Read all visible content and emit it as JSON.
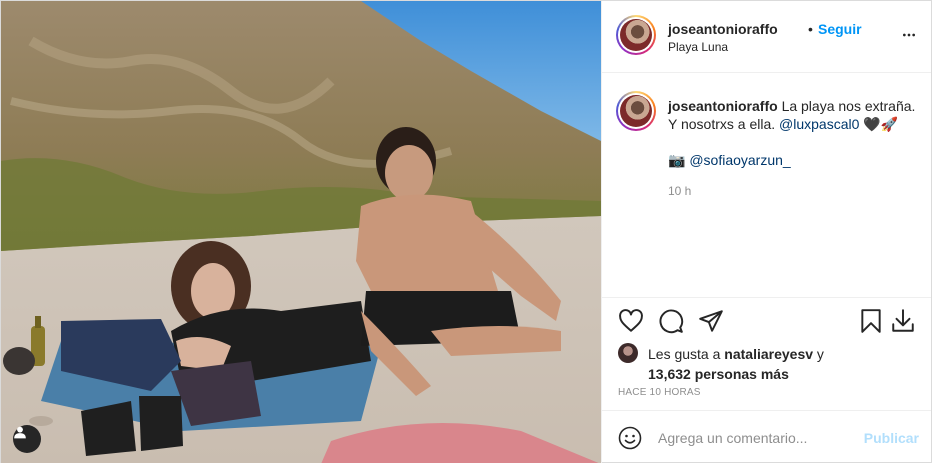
{
  "post": {
    "username": "joseantonioraffo",
    "separator": "•",
    "follow_label": "Seguir",
    "location": "Playa Luna",
    "more_icon": "more-horizontal-icon"
  },
  "caption": {
    "username": "joseantonioraffo",
    "text_line1": "La playa nos extraña.",
    "text_line2": "Y nosotrxs a ella.",
    "mention": "@luxpascal0",
    "emojis": "🖤🚀",
    "credit_icon": "📷",
    "credit_mention": "@sofiaoyarzun_",
    "time": "10 h"
  },
  "actions": {
    "like_icon": "heart-icon",
    "comment_icon": "comment-icon",
    "share_icon": "paper-plane-icon",
    "save_icon": "bookmark-icon",
    "download_icon": "download-icon"
  },
  "likes": {
    "prefix": "Les gusta a",
    "user": "nataliareyesv",
    "conjunction": "y",
    "count": "13,632 personas más"
  },
  "timestamp_full": "HACE 10 HORAS",
  "comment": {
    "placeholder": "Agrega un comentario...",
    "publish_label": "Publicar",
    "emoji_icon": "smiley-icon"
  },
  "photo": {
    "tag_icon": "user-tag-icon"
  }
}
